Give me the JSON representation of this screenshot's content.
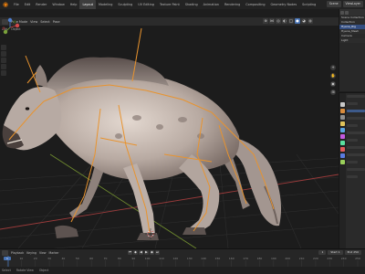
{
  "topbar": {
    "logo_icon": "blender-logo-icon",
    "menus": [
      "File",
      "Edit",
      "Render",
      "Window",
      "Help"
    ],
    "workspaces": [
      "Layout",
      "Modeling",
      "Sculpting",
      "UV Editing",
      "Texture Paint",
      "Shading",
      "Animation",
      "Rendering",
      "Compositing",
      "Geometry Nodes",
      "Scripting"
    ],
    "active_workspace": "Layout",
    "scene_label": "Scene",
    "view_layer_label": "ViewLayer"
  },
  "viewport_header": {
    "mode": "Pose Mode",
    "menus": [
      "View",
      "Select",
      "Pose"
    ],
    "orientation": "Global",
    "sub_items": [
      "Add",
      "Object"
    ]
  },
  "outliner": {
    "rows": [
      "Scene Collection",
      "Collection",
      "Hyena_Rig",
      "Hyena_Mesh",
      "Camera",
      "Light"
    ],
    "selected_index": 2
  },
  "properties": {
    "tab_colors": [
      "#c9c9c9",
      "#d98c3d",
      "#8f8f8f",
      "#e0c35a",
      "#5aa4e0",
      "#c35ae0",
      "#5ae0a0",
      "#e05a5a",
      "#5a7be0",
      "#9ad05a"
    ]
  },
  "timeline": {
    "menus": [
      "Playback",
      "Keying",
      "View",
      "Marker"
    ],
    "playback_icons": [
      "jump-start",
      "prev-key",
      "play-reverse",
      "play",
      "next-key",
      "jump-end"
    ],
    "current_frame": "1",
    "start_label": "Start",
    "start_value": "1",
    "end_label": "End",
    "end_value": "250",
    "ruler_ticks": [
      "0",
      "10",
      "20",
      "30",
      "40",
      "50",
      "60",
      "70",
      "80",
      "90",
      "100",
      "110",
      "120",
      "130",
      "140",
      "150",
      "160",
      "170",
      "180",
      "190",
      "200",
      "210",
      "220",
      "230",
      "240",
      "250"
    ]
  },
  "statusbar": {
    "items": [
      "Select",
      "Rotate View",
      "Object"
    ]
  },
  "colors": {
    "accent": "#4772b3",
    "bone": "#e8932e",
    "grid_x_axis": "#9b3b3b",
    "grid_y_axis": "#6f8b2f",
    "fur": "#c9bfb8"
  }
}
